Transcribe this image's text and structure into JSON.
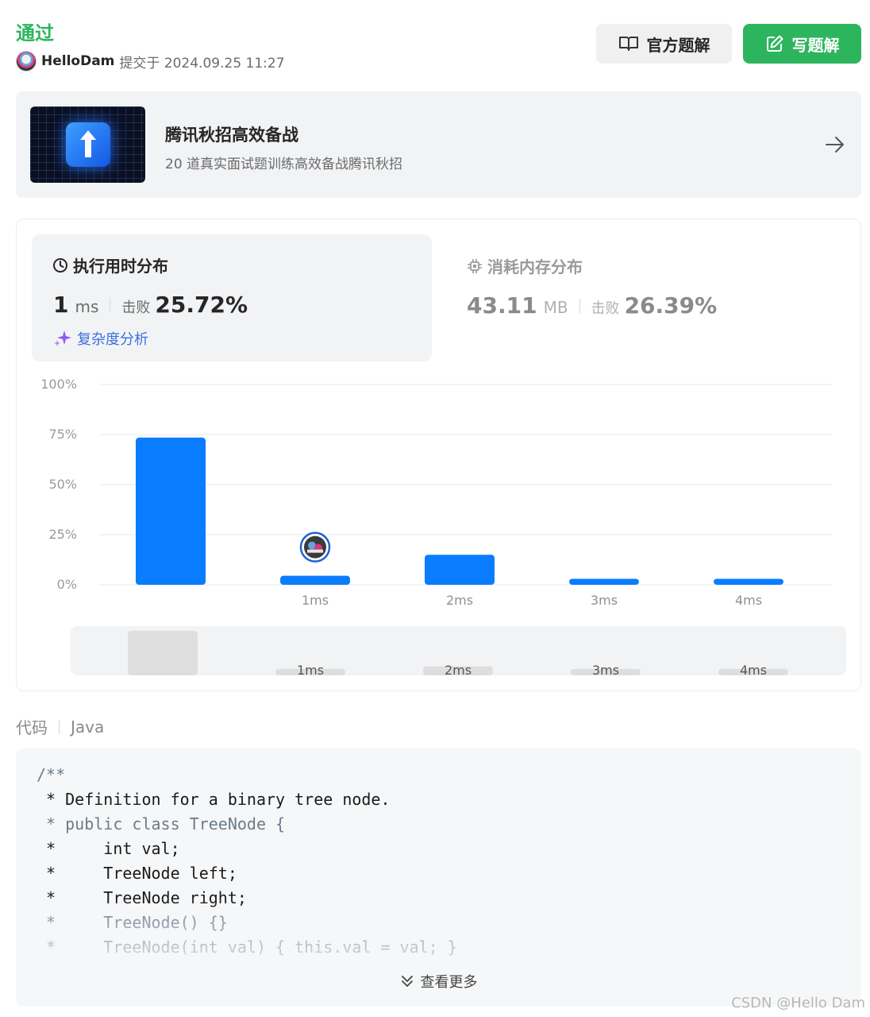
{
  "header": {
    "status": "通过",
    "username": "HelloDam",
    "submitted_text": "提交于 2024.09.25 11:27"
  },
  "buttons": {
    "official_label": "官方题解",
    "write_label": "写题解"
  },
  "promo": {
    "title": "腾讯秋招高效备战",
    "subtitle": "20 道真实面试题训练高效备战腾讯秋招"
  },
  "runtime": {
    "title": "执行用时分布",
    "value": "1",
    "unit": "ms",
    "beat_label": "击败",
    "beat_pct": "25.72%",
    "complexity_label": "复杂度分析"
  },
  "memory": {
    "title": "消耗内存分布",
    "value": "43.11",
    "unit": "MB",
    "beat_label": "击败",
    "beat_pct": "26.39%"
  },
  "chart_data": {
    "type": "bar",
    "categories": [
      "",
      "1ms",
      "2ms",
      "3ms",
      "4ms"
    ],
    "values": [
      73.5,
      4.5,
      15,
      3,
      3
    ],
    "ytick_labels": [
      "100%",
      "75%",
      "50%",
      "25%",
      "0%"
    ],
    "ylim": [
      0,
      100
    ],
    "grid": true,
    "highlight_index": 1,
    "colors": {
      "bar": "#0a7cff",
      "mini_bar": "#dedede"
    }
  },
  "code": {
    "label": "代码",
    "language": "Java",
    "lines": [
      "/**",
      " * Definition for a binary tree node.",
      " * public class TreeNode {",
      " *     int val;",
      " *     TreeNode left;",
      " *     TreeNode right;",
      " *     TreeNode() {}",
      " *     TreeNode(int val) { this.val = val; }"
    ],
    "more_label": "查看更多"
  },
  "watermark": "CSDN @Hello Dam"
}
